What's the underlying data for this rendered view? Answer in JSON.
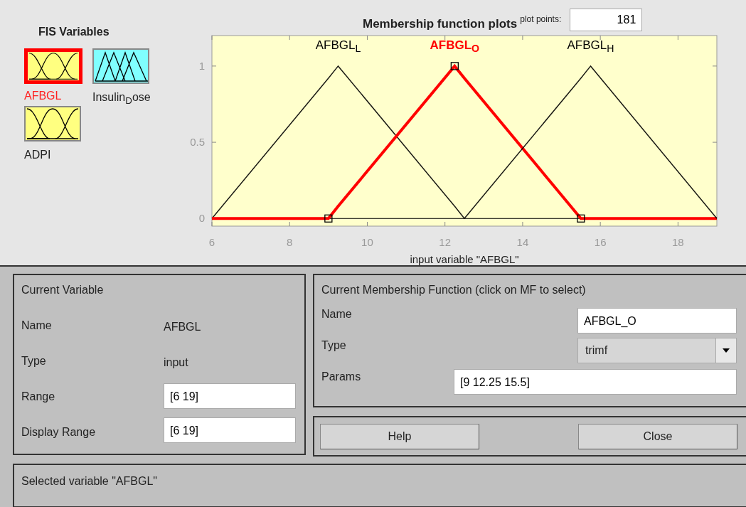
{
  "fis_variables": {
    "title": "FIS Variables",
    "items": [
      {
        "name": "AFBGL",
        "kind": "input",
        "selected": true
      },
      {
        "name": "Insulin$_{D}$ose",
        "kind": "output",
        "selected": false
      },
      {
        "name": "ADPI",
        "kind": "input",
        "selected": false
      }
    ]
  },
  "plot": {
    "plot_points_label": "plot points:",
    "plot_points": "181",
    "chart_data": {
      "type": "line",
      "title": "Membership function plots",
      "xlabel": "input variable \"AFBGL\"",
      "x": [
        6,
        9,
        9.25,
        12.25,
        12.5,
        15.5,
        15.75,
        19
      ],
      "series": [
        {
          "name": "AFBGL$_{L}$",
          "color": "#000000",
          "values": [
            0,
            0.92,
            1,
            0.08,
            0,
            null,
            null,
            null
          ]
        },
        {
          "name": "AFBGL$_{O}$",
          "color": "#ff0000",
          "values": [
            0,
            0,
            0.08,
            1,
            0.92,
            0,
            0,
            0
          ]
        },
        {
          "name": "AFBGL$_{H}$",
          "color": "#000000",
          "values": [
            null,
            null,
            null,
            null,
            0,
            0.92,
            1,
            0
          ]
        }
      ],
      "xlim": [
        6,
        19
      ],
      "ylim": [
        -0.05,
        1.2
      ],
      "xticks": [
        6,
        8,
        10,
        12,
        14,
        16,
        18
      ],
      "yticks": [
        0,
        0.5,
        1
      ]
    },
    "membership_functions": [
      {
        "selected": false
      },
      {
        "selected": true
      },
      {
        "selected": false
      }
    ]
  },
  "current_variable": {
    "title": "Current Variable",
    "name_label": "Name",
    "name": "AFBGL",
    "type_label": "Type",
    "type": "input",
    "range_label": "Range",
    "range": "[6 19]",
    "display_range_label": "Display Range",
    "display_range": "[6 19]"
  },
  "current_mf": {
    "title": "Current Membership Function (click on MF to select)",
    "name_label": "Name",
    "name": "AFBGL_O",
    "type_label": "Type",
    "type": "trimf",
    "params_label": "Params",
    "params": "[9 12.25 15.5]"
  },
  "buttons": [
    "Help",
    "Close"
  ],
  "status": "Selected variable \"AFBGL\""
}
